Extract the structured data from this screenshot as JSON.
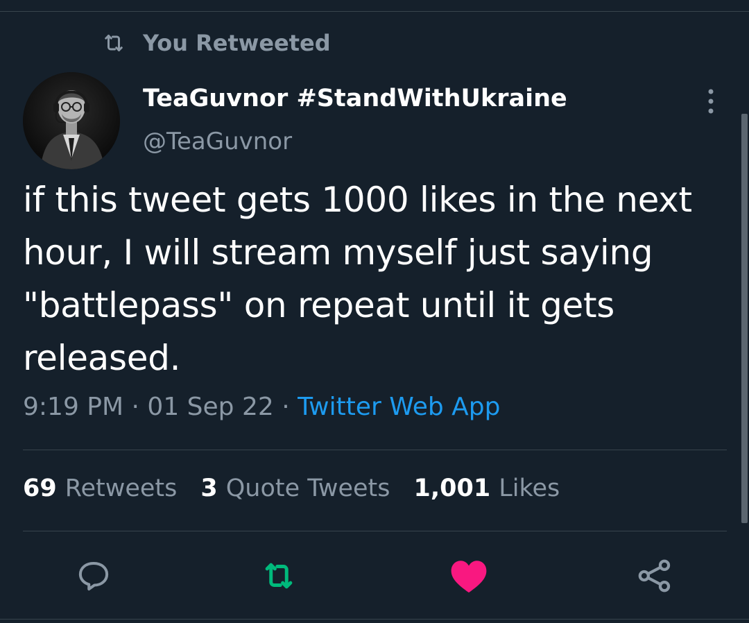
{
  "retweet_context": {
    "label": "You Retweeted",
    "icon": "retweet-icon"
  },
  "author": {
    "display_name": "TeaGuvnor #StandWithUkraine",
    "handle": "@TeaGuvnor",
    "avatar": "avatar-photo"
  },
  "tweet": {
    "text": "if this tweet gets 1000 likes in the next hour, I will stream myself just saying \"battlepass\" on repeat until it gets released.",
    "time": "9:19 PM",
    "date": "01 Sep 22",
    "separator": "·",
    "source": "Twitter Web App"
  },
  "stats": {
    "retweets_count": "69",
    "retweets_label": "Retweets",
    "quotes_count": "3",
    "quotes_label": "Quote Tweets",
    "likes_count": "1,001",
    "likes_label": "Likes"
  },
  "actions": {
    "reply": "reply-icon",
    "retweet": "retweet-icon",
    "like": "heart-icon",
    "share": "share-icon"
  },
  "colors": {
    "background": "#15202b",
    "muted_text": "#8b98a5",
    "link": "#1d9bf0",
    "retweet_active": "#00ba7c",
    "like_active": "#f91880",
    "divider": "#38444d"
  }
}
